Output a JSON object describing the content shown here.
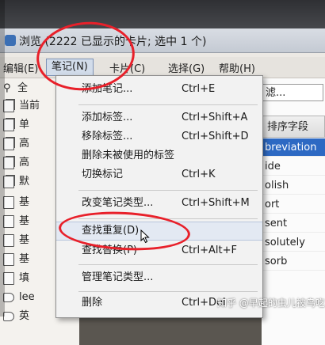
{
  "window": {
    "title": "浏览 (2222 已显示的卡片; 选中 1 个)"
  },
  "menubar": {
    "items": [
      {
        "label": "编辑(E)"
      },
      {
        "label": "笔记(N)"
      },
      {
        "label": "卡片(C)"
      },
      {
        "label": "选择(G)"
      },
      {
        "label": "帮助(H)"
      }
    ]
  },
  "sidebar": {
    "items": [
      {
        "label": "全",
        "icon": "search-icon"
      },
      {
        "label": "当前",
        "icon": "deck-icon"
      },
      {
        "label": "单",
        "icon": "deck-icon"
      },
      {
        "label": "高",
        "icon": "deck-icon"
      },
      {
        "label": "高",
        "icon": "deck-icon"
      },
      {
        "label": "默",
        "icon": "deck-icon"
      },
      {
        "label": "基",
        "icon": "note-type-icon"
      },
      {
        "label": "基",
        "icon": "note-type-icon"
      },
      {
        "label": "基",
        "icon": "note-type-icon"
      },
      {
        "label": "基",
        "icon": "note-type-icon"
      },
      {
        "label": "填",
        "icon": "note-type-icon"
      },
      {
        "label": "lee",
        "icon": "tag-icon"
      },
      {
        "label": "英",
        "icon": "tag-icon"
      }
    ]
  },
  "search": {
    "value": "滤..."
  },
  "table": {
    "sort_column_header": "排序字段",
    "rows": [
      {
        "value": "breviation",
        "selected": true
      },
      {
        "value": "ide",
        "selected": false
      },
      {
        "value": "olish",
        "selected": false
      },
      {
        "value": "ort",
        "selected": false
      },
      {
        "value": "sent",
        "selected": false
      },
      {
        "value": "solutely",
        "selected": false
      },
      {
        "value": "sorb",
        "selected": false
      }
    ]
  },
  "note_menu": {
    "items": [
      {
        "label": "添加笔记...",
        "shortcut": "Ctrl+E"
      },
      {
        "label": "添加标签...",
        "shortcut": "Ctrl+Shift+A"
      },
      {
        "label": "移除标签...",
        "shortcut": "Ctrl+Shift+D"
      },
      {
        "label": "删除未被使用的标签",
        "shortcut": ""
      },
      {
        "label": "切换标记",
        "shortcut": "Ctrl+K"
      },
      {
        "label": "改变笔记类型...",
        "shortcut": "Ctrl+Shift+M"
      },
      {
        "label": "查找重复(D)",
        "shortcut": ""
      },
      {
        "label": "查找替换(P)",
        "shortcut": "Ctrl+Alt+F"
      },
      {
        "label": "管理笔记类型...",
        "shortcut": ""
      },
      {
        "label": "删除",
        "shortcut": "Ctrl+Del"
      }
    ]
  },
  "watermark": {
    "text": "知乎 @早起的虫儿被鸟吃"
  },
  "colors": {
    "annotation_red": "#e8202a",
    "selection_blue": "#2d69c3"
  }
}
